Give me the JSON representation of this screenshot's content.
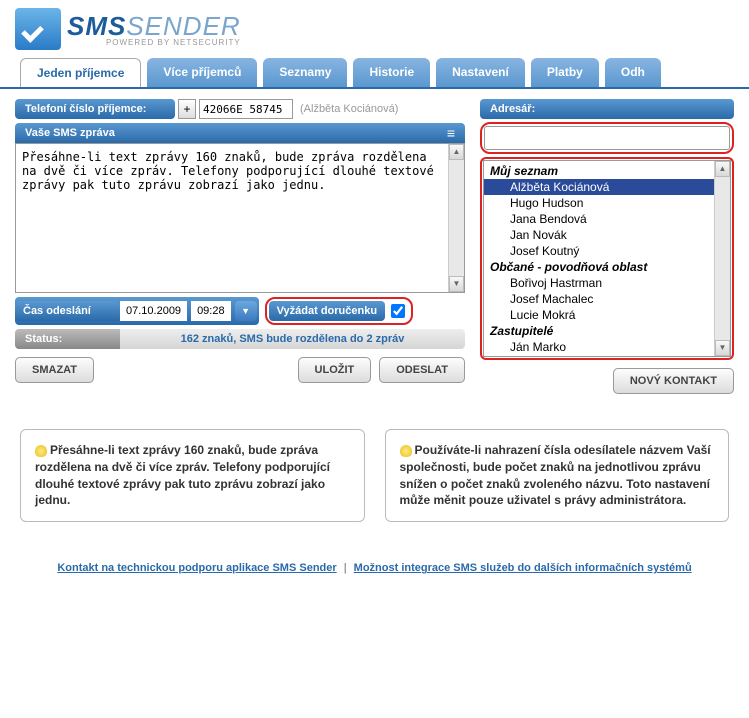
{
  "logo": {
    "brand": "SMS",
    "brand2": "SENDER",
    "sub": "POWERED BY NETSECURITY"
  },
  "tabs": [
    "Jeden příjemce",
    "Více příjemců",
    "Seznamy",
    "Historie",
    "Nastavení",
    "Platby",
    "Odh"
  ],
  "phone": {
    "label": "Telefoní číslo příjemce:",
    "prefix": "+",
    "value": "42066E 58745",
    "name": "(Alžběta Kociánová)"
  },
  "msg": {
    "header": "Vaše SMS zpráva",
    "text": "Přesáhne-li text zprávy 160 znaků, bude zpráva rozdělena na dvě či více zpráv. Telefony podporující dlouhé textové zprávy pak tuto zprávu zobrazí jako jednu. "
  },
  "time": {
    "label": "Čas odeslání",
    "date": "07.10.2009",
    "hour": "09:28"
  },
  "receipt": {
    "label": "Vyžádat doručenku"
  },
  "status": {
    "label": "Status:",
    "text": "162 znaků, SMS bude rozdělena do 2 zpráv"
  },
  "buttons": {
    "clear": "SMAZAT",
    "save": "ULOŽIT",
    "send": "ODESLAT",
    "new_contact": "NOVÝ KONTAKT"
  },
  "addressbook": {
    "label": "Adresář:",
    "groups": [
      {
        "name": "Můj seznam",
        "items": [
          "Alžběta Kociánová",
          "Hugo Hudson",
          "Jana Bendová",
          "Jan Novák",
          "Josef Koutný"
        ],
        "selected": 0
      },
      {
        "name": "Občané - povodňová oblast",
        "items": [
          "Bořivoj Hastrman",
          "Josef Machalec",
          "Lucie Mokrá"
        ]
      },
      {
        "name": "Zastupitelé",
        "items": [
          "Ján Marko"
        ]
      }
    ]
  },
  "tips": {
    "left": "Přesáhne-li text zprávy 160 znaků, bude zpráva rozdělena na dvě či více zpráv. Telefony podporující dlouhé textové zprávy pak tuto zprávu zobrazí jako jednu.",
    "right": "Používáte-li nahrazení čísla odesílatele názvem Vaší společnosti, bude počet znaků na jednotlivou zprávu snížen o počet znaků zvoleného názvu. Toto nastavení může měnit pouze uživatel s právy administrátora."
  },
  "footer": {
    "link1": "Kontakt na technickou podporu aplikace SMS Sender",
    "link2": "Možnost integrace SMS služeb do dalších informačních systémů"
  }
}
